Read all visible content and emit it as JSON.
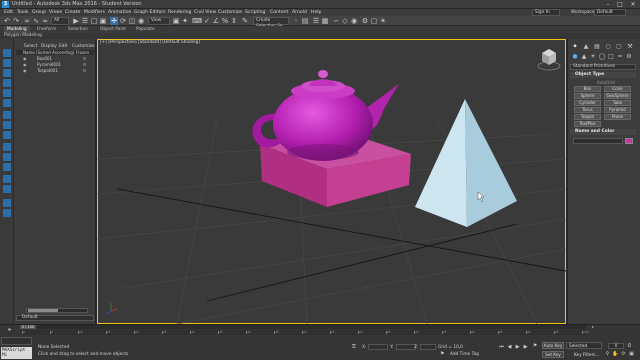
{
  "title_bar": {
    "icon_label": "3",
    "title": "Untitled - Autodesk 3ds Max 2016 - Student Version"
  },
  "menu": [
    "Edit",
    "Tools",
    "Group",
    "Views",
    "Create",
    "Modifiers",
    "Animation",
    "Graph Editors",
    "Rendering",
    "Civil View",
    "Customize",
    "Scripting",
    "Content",
    "Arnold",
    "Help"
  ],
  "account": {
    "sign_in": "Sign In",
    "workspaces_label": "Workspaces:",
    "workspace_value": "Default"
  },
  "toolbar": {
    "reference_coord": "All",
    "view_dropdown": "View",
    "selection_set": "Create Selection Se"
  },
  "ribbon": {
    "tabs": [
      "Modeling",
      "Freeform",
      "Selection",
      "Object Paint",
      "Populate"
    ],
    "sub_label": "Polygon Modeling"
  },
  "scene_explorer": {
    "tabs": [
      "Select",
      "Display",
      "Edit",
      "Customize"
    ],
    "col_name": "Name (Sorted Ascending)",
    "col_frozen": "Frozen",
    "rows": [
      "Box001",
      "Pyramid001",
      "Teapot001"
    ],
    "layer": "Default"
  },
  "viewport": {
    "label": "[+] [Perspective] [Standard] [Default Shading]"
  },
  "command_panel": {
    "category": "Standard Primitives",
    "object_type_title": "Object Type",
    "autogrid": "AutoGrid",
    "buttons": [
      "Box",
      "Cone",
      "Sphere",
      "GeoSphere",
      "Cylinder",
      "Tube",
      "Torus",
      "Pyramid",
      "Teapot",
      "Plane",
      "TextPlus"
    ],
    "name_color_title": "Name and Color",
    "color": "#c0399c"
  },
  "timeline": {
    "slider": "0 / 100",
    "ticks": [
      "0",
      "5",
      "10",
      "15",
      "20",
      "25",
      "30",
      "35",
      "40",
      "45",
      "50",
      "55",
      "60",
      "65",
      "70",
      "75",
      "80",
      "85",
      "90",
      "95",
      "100"
    ]
  },
  "status": {
    "maxscript": "MAXScript Mi",
    "selection": "None Selected",
    "prompt": "Click and drag to select and move objects",
    "x_label": "X:",
    "y_label": "Y:",
    "z_label": "Z:",
    "grid": "Grid = 10,0",
    "add_time_tag": "Add Time Tag",
    "auto_key": "Auto Key",
    "set_key": "Set Key",
    "selected": "Selected",
    "key_filters": "Key Filters...",
    "frame": "0"
  },
  "colors": {
    "teapot": "#c42cb8",
    "box": "#c43a8e",
    "pyramid": "#b9d8e6",
    "viewport_border": "#f0c419"
  }
}
